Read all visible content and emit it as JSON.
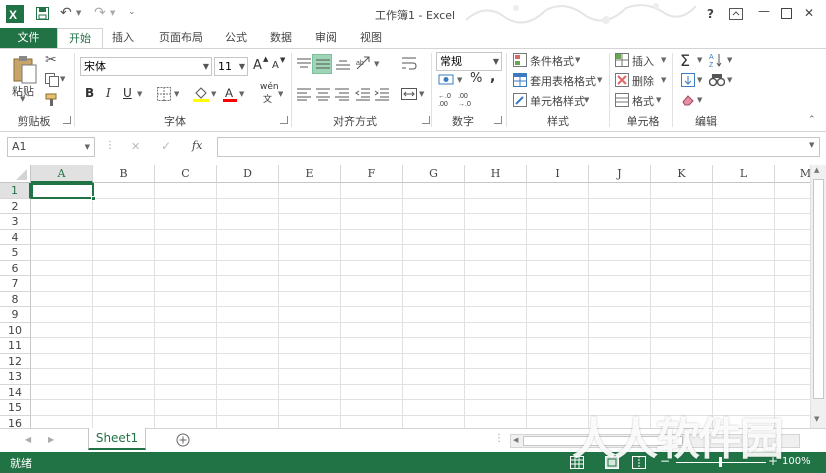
{
  "window": {
    "title": "工作簿1 - Excel",
    "help": "?",
    "minimize": "—",
    "close": "✕"
  },
  "qat": {
    "undo": "↶",
    "redo": "↷"
  },
  "tabs": [
    "文件",
    "开始",
    "插入",
    "页面布局",
    "公式",
    "数据",
    "审阅",
    "视图"
  ],
  "ribbon": {
    "clipboard": {
      "paste": "粘贴",
      "label": "剪贴板"
    },
    "font": {
      "name": "宋体",
      "size": "11",
      "bold": "B",
      "italic": "I",
      "underline": "U",
      "grow": "A",
      "shrink": "A",
      "phonetic": "wén",
      "label": "字体"
    },
    "alignment": {
      "label": "对齐方式"
    },
    "number": {
      "format": "常规",
      "percent": "%",
      "comma": ",",
      "label": "数字"
    },
    "styles": {
      "conditional": "条件格式",
      "table": "套用表格格式",
      "cell": "单元格样式",
      "label": "样式"
    },
    "cells": {
      "insert": "插入",
      "delete": "删除",
      "format": "格式",
      "label": "单元格"
    },
    "editing": {
      "sum": "Σ",
      "label": "编辑"
    }
  },
  "formula": {
    "namebox": "A1",
    "cancel": "✕",
    "enter": "✓",
    "fx": "fx"
  },
  "columns": [
    "A",
    "B",
    "C",
    "D",
    "E",
    "F",
    "G",
    "H",
    "I",
    "J",
    "K",
    "L",
    "M"
  ],
  "rows": [
    "1",
    "2",
    "3",
    "4",
    "5",
    "6",
    "7",
    "8",
    "9",
    "10",
    "11",
    "12",
    "13",
    "14",
    "15",
    "16"
  ],
  "sheets": [
    "Sheet1"
  ],
  "status": {
    "ready": "就绪",
    "zoom": "100%"
  },
  "watermark": "人人软件园",
  "colors": {
    "accent": "#217346",
    "selection": "#217346"
  }
}
